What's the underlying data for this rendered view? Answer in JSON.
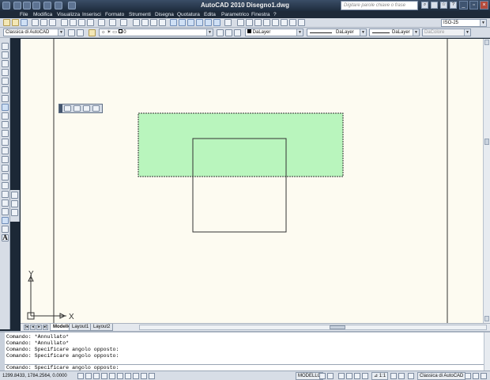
{
  "app": {
    "title": "AutoCAD 2010    Disegno1.dwg",
    "search_placeholder": "Digitare parole chiave o frase"
  },
  "menu": [
    "File",
    "Modifica",
    "Visualizza",
    "Inserisci",
    "Formato",
    "Strumenti",
    "Disegna",
    "Quotatura",
    "Edita",
    "Parametrico",
    "Finestra",
    "?"
  ],
  "toolbar": {
    "workspace": "Classica di AutoCAD",
    "layer": "0",
    "color": "DaLayer",
    "linetype": "DaLayer",
    "lineweight": "DaLayer",
    "plotstyle": "DaColore",
    "dimstyle": "ISO-25"
  },
  "ucs": {
    "x_label": "X",
    "y_label": "Y"
  },
  "tabs": [
    "Modello",
    "Layout1",
    "Layout2"
  ],
  "active_tab": "Modello",
  "command_history": [
    "Comando: *Annullato*",
    "Comando: *Annullato*",
    "Comando: Specificare angolo opposto:",
    "Comando: Specificare angolo opposto:"
  ],
  "command_prompt": "Comando: Specificare angolo opposto:",
  "status": {
    "coordinates": "1299.8433, 1784.2564, 0.0000",
    "space_button": "MODELLO",
    "annotation_scale": "1:1",
    "workspace": "Classica di AutoCAD"
  },
  "colors": {
    "canvas": "#fdfbf1",
    "selection_window": "#b9f5bd",
    "titlebar": "#2a3a4f"
  }
}
